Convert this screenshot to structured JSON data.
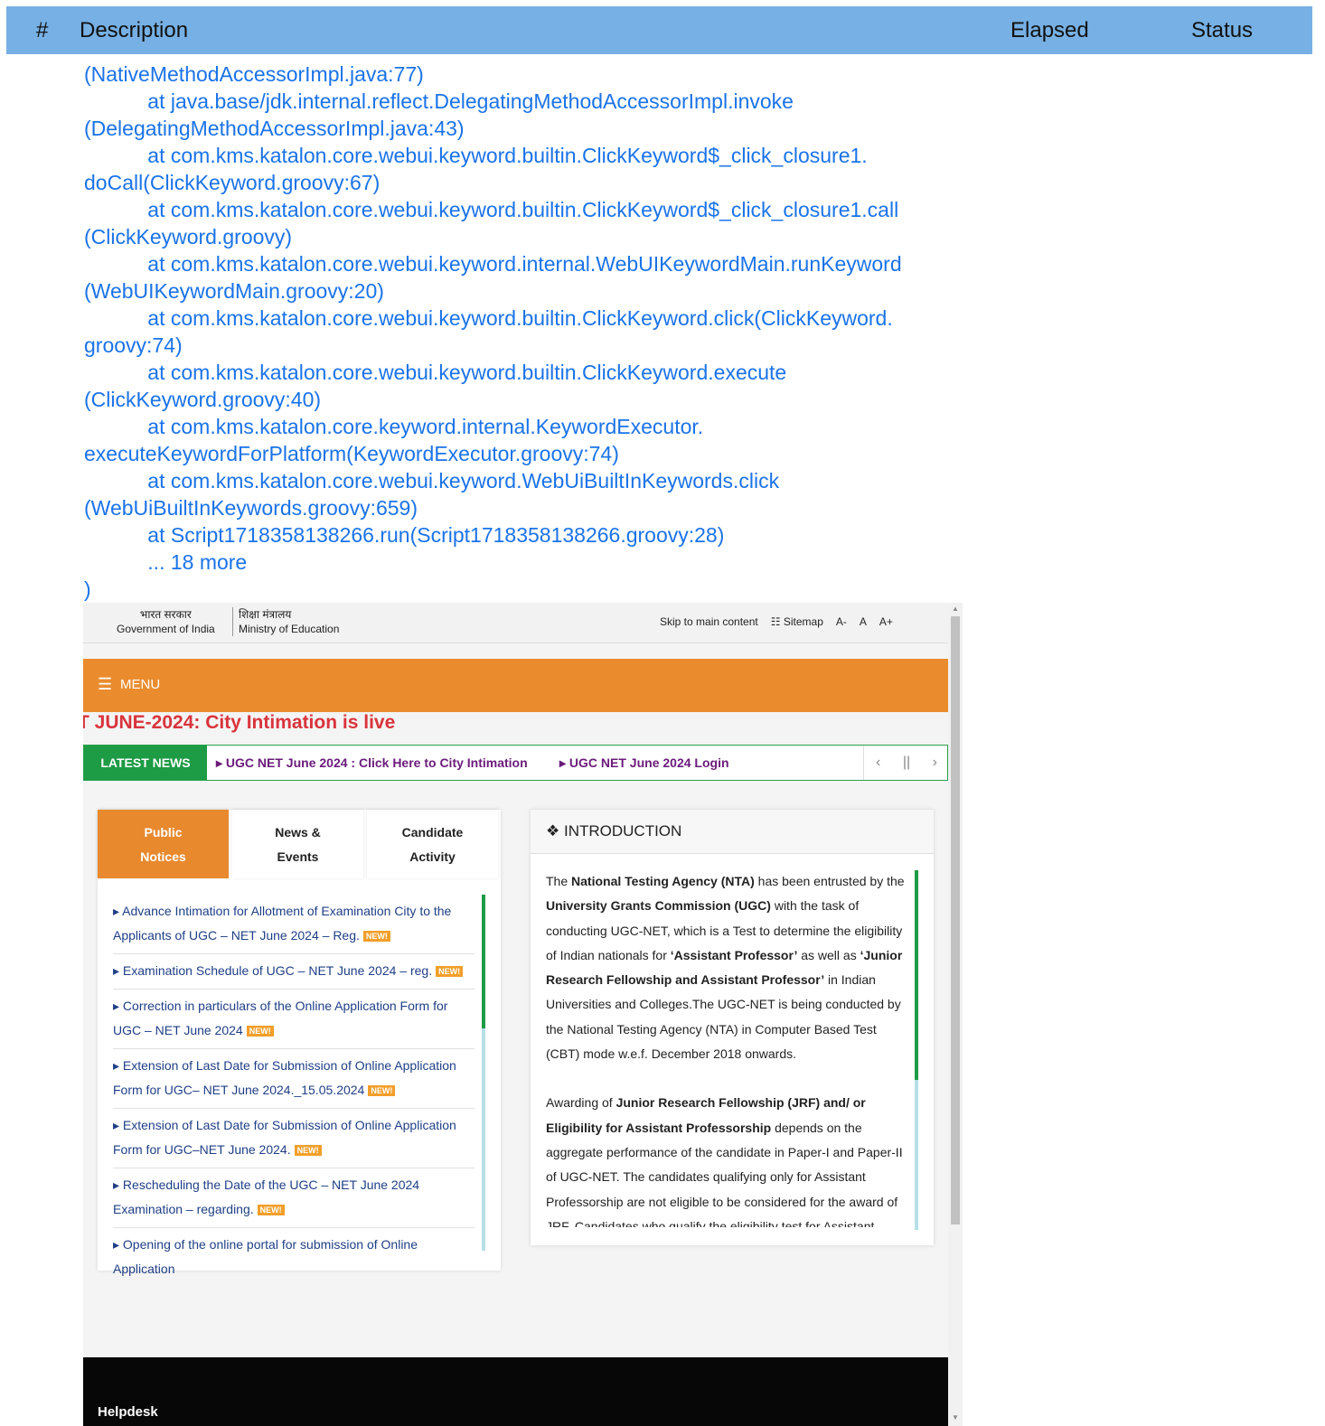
{
  "report": {
    "col_num": "#",
    "col_desc": "Description",
    "col_elapsed": "Elapsed",
    "col_status": "Status"
  },
  "log_lines": [
    "(NativeMethodAccessorImpl.java:77)",
    "           at java.base/jdk.internal.reflect.DelegatingMethodAccessorImpl.invoke",
    "(DelegatingMethodAccessorImpl.java:43)",
    "           at com.kms.katalon.core.webui.keyword.builtin.ClickKeyword$_click_closure1.",
    "doCall(ClickKeyword.groovy:67)",
    "           at com.kms.katalon.core.webui.keyword.builtin.ClickKeyword$_click_closure1.call",
    "(ClickKeyword.groovy)",
    "           at com.kms.katalon.core.webui.keyword.internal.WebUIKeywordMain.runKeyword",
    "(WebUIKeywordMain.groovy:20)",
    "           at com.kms.katalon.core.webui.keyword.builtin.ClickKeyword.click(ClickKeyword.",
    "groovy:74)",
    "           at com.kms.katalon.core.webui.keyword.builtin.ClickKeyword.execute",
    "(ClickKeyword.groovy:40)",
    "           at com.kms.katalon.core.keyword.internal.KeywordExecutor.",
    "executeKeywordForPlatform(KeywordExecutor.groovy:74)",
    "           at com.kms.katalon.core.webui.keyword.WebUiBuiltInKeywords.click",
    "(WebUiBuiltInKeywords.groovy:659)",
    "           at Script1718358138266.run(Script1718358138266.groovy:28)",
    "           ... 18 more",
    ")"
  ],
  "site": {
    "gov_hindi": "भारत सरकार",
    "gov_english": "Government of India",
    "ministry_hindi": "शिक्षा मंत्रालय",
    "ministry_english": "Ministry of Education",
    "skip_link": "Skip to main content",
    "sitemap": "Sitemap",
    "font_small": "A-",
    "font_normal": "A",
    "font_large": "A+",
    "menu_label": "MENU",
    "marquee": "T JUNE-2024: City Intimation is live",
    "latest_news_label": "LATEST NEWS",
    "news_items": [
      "UGC NET June 2024 : Click Here to City Intimation",
      "UGC NET June 2024 Login"
    ],
    "tabs": [
      {
        "line1": "Public",
        "line2": "Notices"
      },
      {
        "line1": "News &",
        "line2": "Events"
      },
      {
        "line1": "Candidate",
        "line2": "Activity"
      }
    ],
    "new_badge": "NEW!",
    "notices": [
      "Advance Intimation for Allotment of Examination City to the Applicants of UGC – NET June 2024 – Reg.",
      "Examination Schedule of UGC – NET June 2024 – reg.",
      "Correction in particulars of the Online Application Form for UGC – NET June 2024",
      "Extension of Last Date for Submission of Online Application Form for UGC– NET June 2024._15.05.2024",
      "Extension of Last Date for Submission of Online Application Form for UGC–NET June 2024.",
      "Rescheduling the Date of the UGC – NET June 2024 Examination – regarding.",
      "Opening of the online portal for submission of Online Application"
    ],
    "intro_title": "INTRODUCTION",
    "intro_p1": {
      "t1": "The ",
      "b1": "National Testing Agency (NTA)",
      "t2": " has been entrusted by the ",
      "b2": "University Grants Commission (UGC)",
      "t3": " with the task of conducting UGC-NET, which is a Test to determine the eligibility of Indian nationals for ",
      "b3": "‘Assistant Professor’",
      "t4": " as well as ",
      "b4": "‘Junior Research Fellowship and Assistant Professor’",
      "t5": " in Indian Universities and Colleges.The UGC-NET is being conducted by the National Testing Agency (NTA) in Computer Based Test (CBT) mode w.e.f. December 2018 onwards."
    },
    "intro_p2": {
      "t1": "Awarding of ",
      "b1": "Junior Research Fellowship (JRF) and/ or Eligibility for Assistant Professorship",
      "t2": " depends on the aggregate performance of the candidate in Paper-I and Paper-II of UGC-NET. The candidates qualifying only for Assistant Professorship are not eligible to be considered for the award of JRF. Candidates who qualify the eligibility test for Assistant"
    },
    "footer_heading": "Helpdesk"
  },
  "colors": {
    "header_bg": "#76b0e4",
    "log_text": "#1a73e8",
    "menu_bg": "#ea8c2e",
    "news_green": "#1e9b45",
    "marquee_red": "#d9343c"
  }
}
